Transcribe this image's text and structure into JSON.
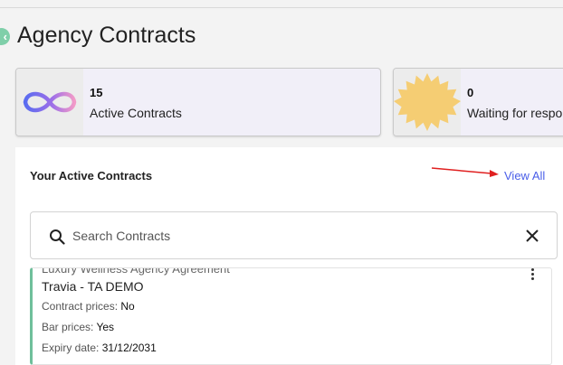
{
  "page": {
    "title": "Agency Contracts"
  },
  "stats": [
    {
      "count": "15",
      "label": "Active Contracts",
      "icon": "infinity-icon"
    },
    {
      "count": "0",
      "label": "Waiting for response",
      "icon": "sunburst-icon"
    }
  ],
  "panel": {
    "heading": "Your Active Contracts",
    "view_all": "View All"
  },
  "search": {
    "placeholder": "Search Contracts",
    "value": ""
  },
  "contract": {
    "cut_off_line": "Luxury Wellness Agency Agreement",
    "name": "Travia - TA DEMO",
    "contract_prices_label": "Contract prices:",
    "contract_prices_value": "No",
    "bar_prices_label": "Bar prices:",
    "bar_prices_value": "Yes",
    "expiry_label": "Expiry date:",
    "expiry_value": "31/12/2031"
  },
  "colors": {
    "accent_green": "#6fbf9b",
    "link_blue": "#4a5ee8",
    "annotation_red": "#e02020",
    "card_bg": "#f1eff8"
  }
}
